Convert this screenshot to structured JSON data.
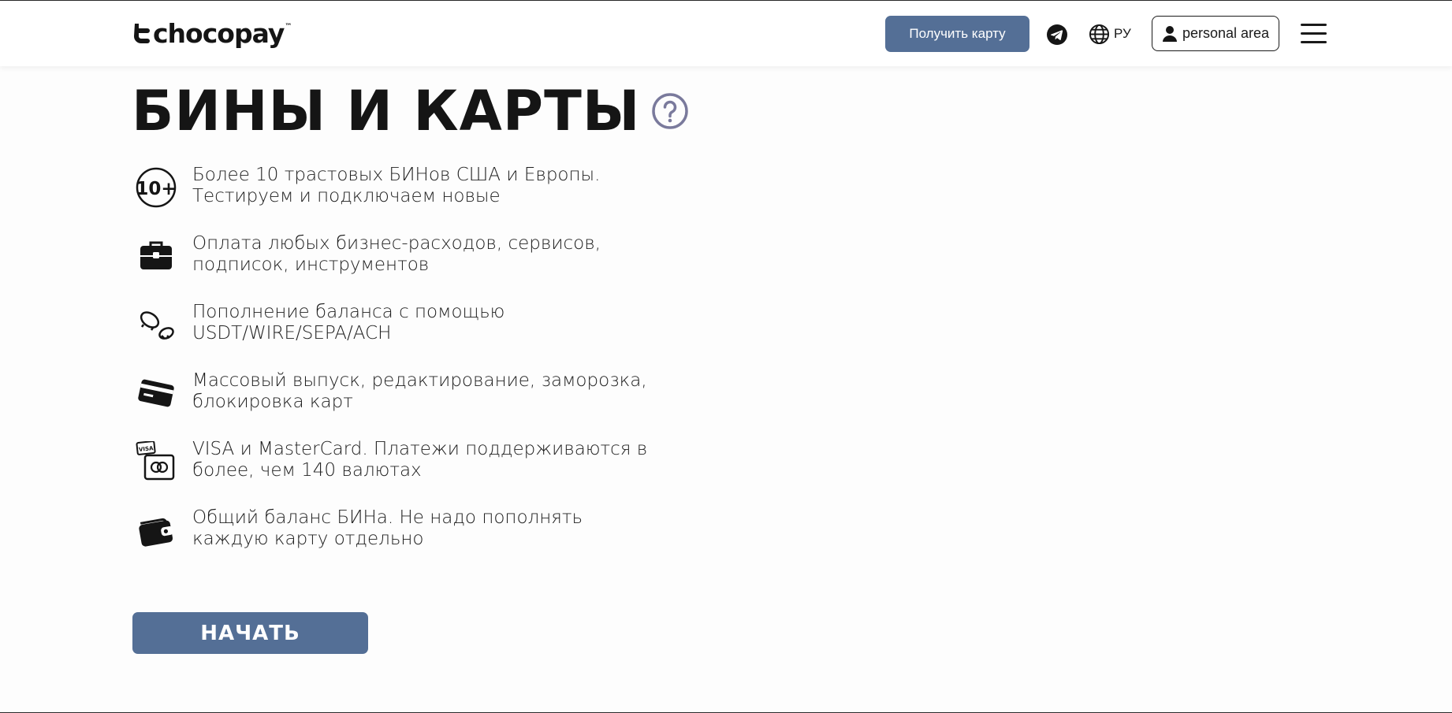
{
  "header": {
    "logo_text": "chocopay",
    "logo_tm": "™",
    "get_card_label": "Получить карту",
    "lang_label": "РУ",
    "personal_area_label": "personal area",
    "icons": {
      "logo": "chocopay-logo-icon",
      "telegram": "telegram-icon",
      "globe": "globe-icon",
      "user": "user-icon",
      "menu": "hamburger-menu-icon"
    }
  },
  "main": {
    "title": "БИНЫ И КАРТЫ",
    "help_icon": "question-circle-icon",
    "features": [
      {
        "icon": "ten-plus-icon",
        "text": "Более 10 трастовых БИНов США и Европы.\nТестируем и подключаем новые"
      },
      {
        "icon": "briefcase-icon",
        "text": "Оплата любых бизнес-расходов, сервисов,\nподписок, инструментов"
      },
      {
        "icon": "coins-icon",
        "text": "Пополнение баланса с помощью\nUSDT/WIRE/SEPA/ACH"
      },
      {
        "icon": "credit-card-icon",
        "text": "Массовый выпуск, редактирование, заморозка,\nблокировка карт"
      },
      {
        "icon": "visa-mastercard-icon",
        "text": "VISA и MasterCard. Платежи поддерживаются в\nболее, чем 140 валютах"
      },
      {
        "icon": "wallet-icon",
        "text": "Общий баланс БИНа. Не надо пополнять\nкаждую карту отдельно"
      }
    ],
    "start_label": "НАЧАТЬ"
  },
  "colors": {
    "accent": "#546f96",
    "text": "#1a1a1a",
    "help_icon": "#7a7a9c",
    "background": "#fdfdfd"
  }
}
